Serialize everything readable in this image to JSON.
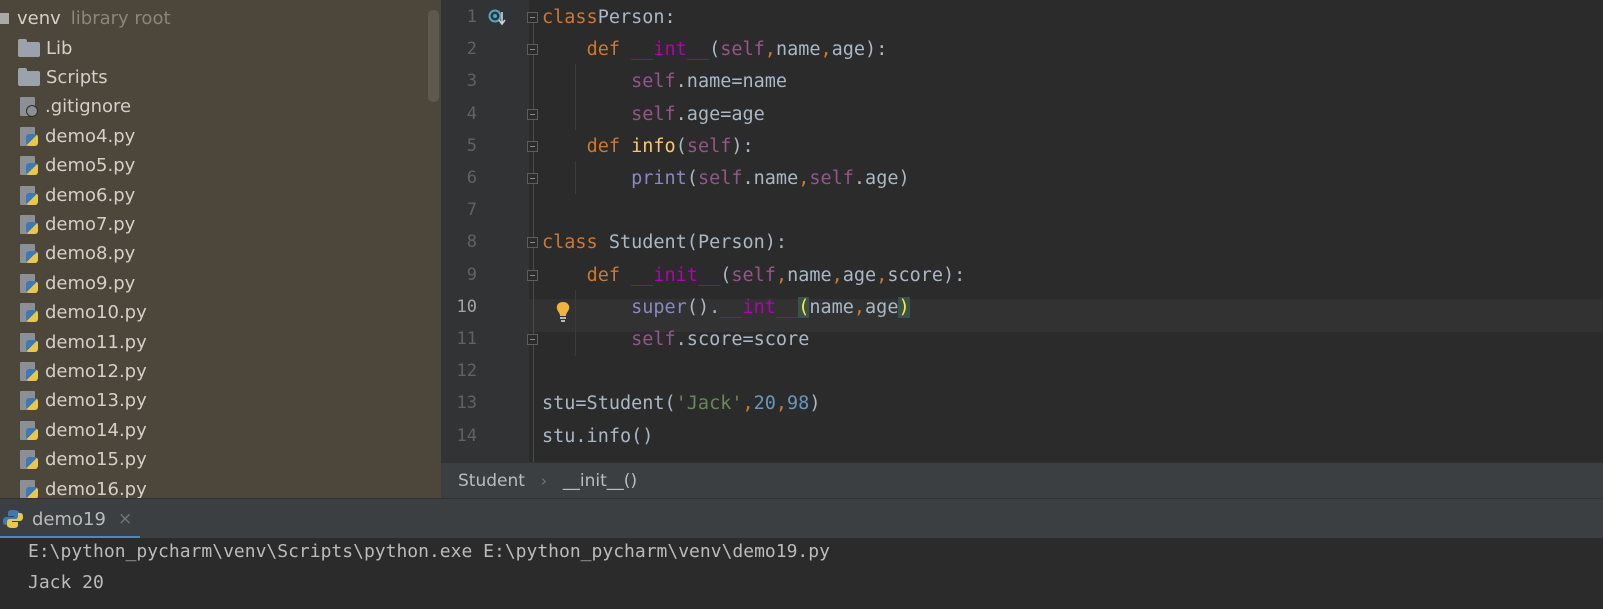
{
  "project_tree": {
    "root": {
      "name": "venv",
      "suffix": "library root"
    },
    "items": [
      {
        "label": "Lib",
        "icon": "folder-icon"
      },
      {
        "label": "Scripts",
        "icon": "folder-icon"
      },
      {
        "label": ".gitignore",
        "icon": "ignored-file-icon"
      },
      {
        "label": "demo4.py",
        "icon": "python-file-icon"
      },
      {
        "label": "demo5.py",
        "icon": "python-file-icon"
      },
      {
        "label": "demo6.py",
        "icon": "python-file-icon"
      },
      {
        "label": "demo7.py",
        "icon": "python-file-icon"
      },
      {
        "label": "demo8.py",
        "icon": "python-file-icon"
      },
      {
        "label": "demo9.py",
        "icon": "python-file-icon"
      },
      {
        "label": "demo10.py",
        "icon": "python-file-icon"
      },
      {
        "label": "demo11.py",
        "icon": "python-file-icon"
      },
      {
        "label": "demo12.py",
        "icon": "python-file-icon"
      },
      {
        "label": "demo13.py",
        "icon": "python-file-icon"
      },
      {
        "label": "demo14.py",
        "icon": "python-file-icon"
      },
      {
        "label": "demo15.py",
        "icon": "python-file-icon"
      },
      {
        "label": "demo16.py",
        "icon": "python-file-icon"
      }
    ]
  },
  "editor": {
    "line_numbers": [
      "1",
      "2",
      "3",
      "4",
      "5",
      "6",
      "7",
      "8",
      "9",
      "10",
      "11",
      "12",
      "13",
      "14"
    ],
    "current_line": "10",
    "lines": [
      [
        [
          "kw",
          "class"
        ],
        [
          "",
          "Person:"
        ]
      ],
      [
        [
          "",
          "    "
        ],
        [
          "kw",
          "def "
        ],
        [
          "magic",
          "__int__"
        ],
        [
          "",
          "("
        ],
        [
          "slf",
          "self"
        ],
        [
          "kw",
          ","
        ],
        [
          "",
          "name"
        ],
        [
          "kw",
          ","
        ],
        [
          "",
          "age):"
        ]
      ],
      [
        [
          "",
          "        "
        ],
        [
          "slf",
          "self"
        ],
        [
          "",
          ".name=name"
        ]
      ],
      [
        [
          "",
          "        "
        ],
        [
          "slf",
          "self"
        ],
        [
          "",
          ".age=age"
        ]
      ],
      [
        [
          "",
          "    "
        ],
        [
          "kw",
          "def "
        ],
        [
          "fn",
          "info"
        ],
        [
          "",
          "("
        ],
        [
          "slf",
          "self"
        ],
        [
          "",
          "):"
        ]
      ],
      [
        [
          "",
          "        "
        ],
        [
          "bi",
          "print"
        ],
        [
          "",
          "("
        ],
        [
          "slf",
          "self"
        ],
        [
          "",
          ".name"
        ],
        [
          "kw",
          ","
        ],
        [
          "slf",
          "self"
        ],
        [
          "",
          ".age)"
        ]
      ],
      [],
      [
        [
          "kw",
          "class"
        ],
        [
          "",
          " Student(Person):"
        ]
      ],
      [
        [
          "",
          "    "
        ],
        [
          "kw",
          "def "
        ],
        [
          "magic",
          "__init__"
        ],
        [
          "",
          "("
        ],
        [
          "slf",
          "self"
        ],
        [
          "kw",
          ","
        ],
        [
          "",
          "name"
        ],
        [
          "kw",
          ","
        ],
        [
          "",
          "age"
        ],
        [
          "kw",
          ","
        ],
        [
          "",
          "score):"
        ]
      ],
      [
        [
          "",
          "        "
        ],
        [
          "bi",
          "super"
        ],
        [
          "",
          "()."
        ],
        [
          "magic",
          "__int__"
        ],
        [
          "brace",
          "("
        ],
        [
          "",
          "name"
        ],
        [
          "kw",
          ","
        ],
        [
          "",
          "age"
        ],
        [
          "brace",
          ")"
        ]
      ],
      [
        [
          "",
          "        "
        ],
        [
          "slf",
          "self"
        ],
        [
          "",
          ".score=score"
        ]
      ],
      [],
      [
        [
          "",
          "stu=Student("
        ],
        [
          "str",
          "'Jack'"
        ],
        [
          "kw",
          ","
        ],
        [
          "num",
          "20"
        ],
        [
          "kw",
          ","
        ],
        [
          "num",
          "98"
        ],
        [
          "",
          ")"
        ]
      ],
      [
        [
          "",
          "stu.info()"
        ]
      ]
    ]
  },
  "breadcrumb": {
    "items": [
      "Student",
      "__init__()"
    ]
  },
  "run": {
    "tab_label": "demo19",
    "tab_close": "×",
    "output": [
      "E:\\python_pycharm\\venv\\Scripts\\python.exe E:\\python_pycharm\\venv\\demo19.py",
      "Jack 20"
    ]
  },
  "colors": {
    "keyword": "#cc7832",
    "function": "#ffc66d",
    "magic": "#b200b2",
    "self": "#94558d",
    "builtin": "#8888c6",
    "number": "#6897bb",
    "string": "#6a8759",
    "default": "#a9b7c6"
  }
}
